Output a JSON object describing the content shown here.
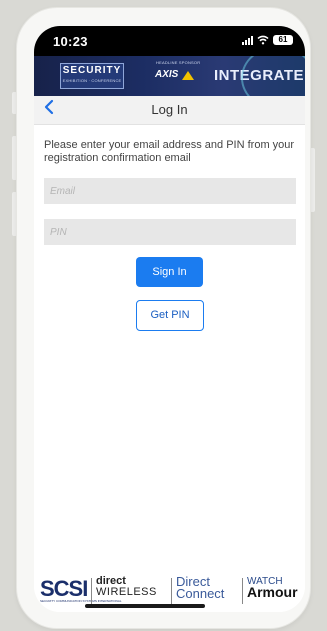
{
  "status_bar": {
    "time": "10:23",
    "battery": "61"
  },
  "banner": {
    "security_logo": "SECURITY",
    "security_logo_sub": "EXHIBITION · CONFERENCE",
    "sponsor_label": "HEADLINE SPONSOR",
    "axis_logo": "AXIS",
    "integrate": "INTEGRATE"
  },
  "nav": {
    "back_icon": "chevron-left-icon",
    "title": "Log In"
  },
  "login": {
    "instructions": "Please enter your email address and PIN from your registration confirmation email",
    "email_placeholder": "Email",
    "pin_placeholder": "PIN",
    "sign_in_label": "Sign In",
    "get_pin_label": "Get PIN"
  },
  "sponsors": {
    "scsi": "SCSI",
    "scsi_sub": "SECURITY COMMUNICATION SYSTEMS INTERNATIONAL",
    "direct_wireless_top": "direct",
    "direct_wireless_bottom": "WIRELESS",
    "direct_connect_top": "Direct",
    "direct_connect_bottom": "Connect",
    "watch_armour_top": "WATCH",
    "watch_armour_bottom": "Armour"
  },
  "colors": {
    "accent": "#1b7cf0",
    "banner": "#1c2d63",
    "nav_bg": "#f2f2f2",
    "field_bg": "#e7e7e7"
  }
}
